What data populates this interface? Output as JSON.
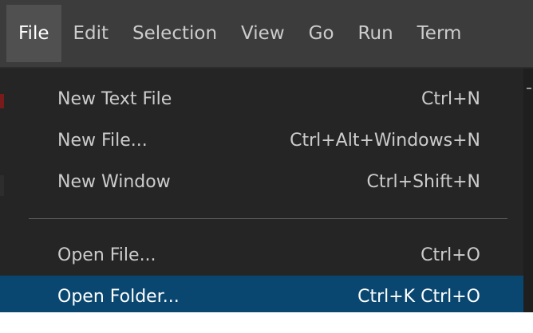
{
  "menubar": {
    "items": [
      {
        "label": "File"
      },
      {
        "label": "Edit"
      },
      {
        "label": "Selection"
      },
      {
        "label": "View"
      },
      {
        "label": "Go"
      },
      {
        "label": "Run"
      },
      {
        "label": "Term"
      }
    ]
  },
  "file_menu": {
    "group1": [
      {
        "label": "New Text File",
        "shortcut": "Ctrl+N"
      },
      {
        "label": "New File...",
        "shortcut": "Ctrl+Alt+Windows+N"
      },
      {
        "label": "New Window",
        "shortcut": "Ctrl+Shift+N"
      }
    ],
    "group2": [
      {
        "label": "Open File...",
        "shortcut": "Ctrl+O"
      },
      {
        "label": "Open Folder...",
        "shortcut": "Ctrl+K Ctrl+O"
      }
    ]
  },
  "colors": {
    "menubar_bg": "#3c3c3c",
    "menu_bg": "#252526",
    "selected_bg": "#094771",
    "text": "#cccccc"
  }
}
